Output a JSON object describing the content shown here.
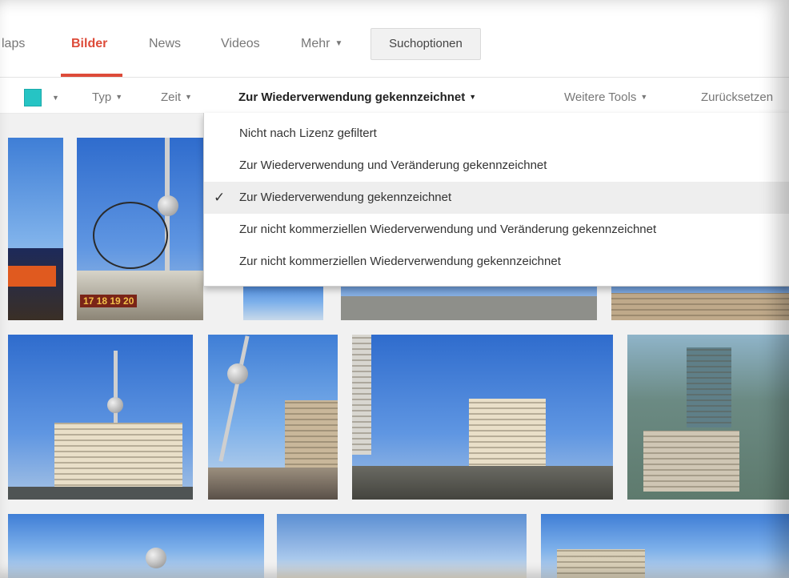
{
  "nav": {
    "tabs": [
      {
        "label": "laps"
      },
      {
        "label": "Bilder"
      },
      {
        "label": "News"
      },
      {
        "label": "Videos"
      },
      {
        "label": "Mehr"
      }
    ],
    "search_options": "Suchoptionen"
  },
  "tools": {
    "color_swatch": "#26c4c4",
    "type": "Typ",
    "time": "Zeit",
    "license": "Zur Wiederverwendung gekennzeichnet",
    "more_tools": "Weitere Tools",
    "reset": "Zurücksetzen"
  },
  "license_menu": {
    "items": [
      {
        "label": "Nicht nach Lizenz gefiltert"
      },
      {
        "label": "Zur Wiederverwendung und Veränderung gekennzeichnet"
      },
      {
        "label": "Zur Wiederverwendung gekennzeichnet",
        "selected": true
      },
      {
        "label": "Zur nicht kommerziellen Wiederverwendung und Veränderung gekennzeichnet"
      },
      {
        "label": "Zur nicht kommerziellen Wiederverwendung gekennzeichnet"
      }
    ],
    "check_icon": "checkmark"
  },
  "colors": {
    "accent": "#dd4b39",
    "swatch": "#26c4c4"
  },
  "world_clock_numbers": "17 18 19 20"
}
